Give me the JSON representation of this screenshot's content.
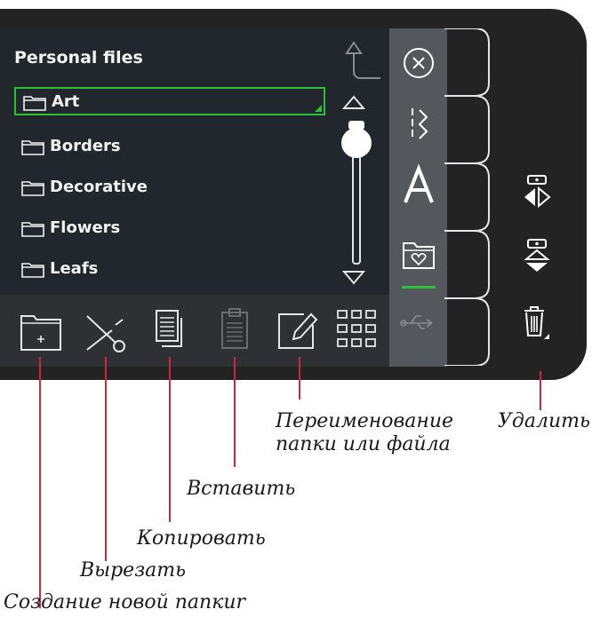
{
  "panel": {
    "title": "Personal files",
    "files": [
      {
        "name": "Art",
        "selected": true
      },
      {
        "name": "Borders",
        "selected": false
      },
      {
        "name": "Decorative",
        "selected": false
      },
      {
        "name": "Flowers",
        "selected": false
      },
      {
        "name": "Leafs",
        "selected": false
      }
    ]
  },
  "toolbar": {
    "buttons": [
      "new-folder-icon",
      "cut-icon",
      "copy-icon",
      "paste-icon",
      "rename-icon",
      "grid-view-icon"
    ],
    "paste_enabled": false
  },
  "side_strip": {
    "buttons": [
      "close-icon",
      "stitch-menu-icon",
      "font-menu-icon",
      "personal-files-icon",
      "usb-icon"
    ],
    "active": "personal-files-icon"
  },
  "right_icons": [
    "mirror-side-icon",
    "mirror-end-icon",
    "delete-icon"
  ],
  "annotations": {
    "rename": "Переименование\nпапки или файла",
    "delete": "Удалить",
    "paste": "Вставить",
    "copy": "Копировать",
    "cut": "Вырезать",
    "new_folder": "Создание новой папкиr"
  },
  "colors": {
    "accent": "#2fbe3c",
    "callout": "#c62a3c",
    "machine": "#232323"
  }
}
